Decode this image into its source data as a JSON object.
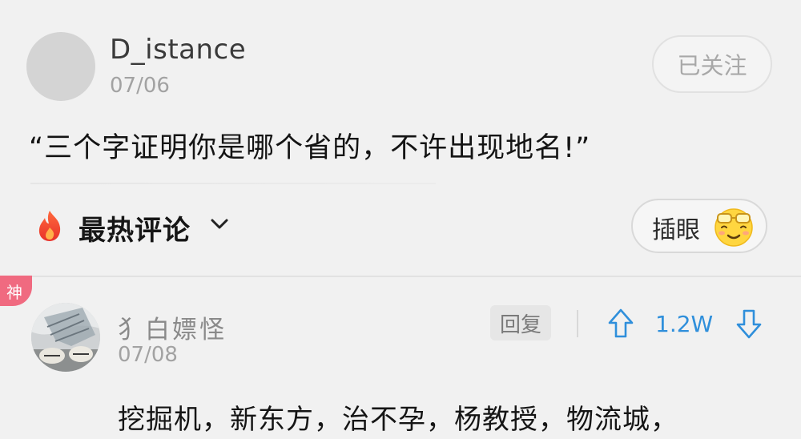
{
  "post": {
    "username": "D_istance",
    "date": "07/06",
    "follow_label": "已关注",
    "title": "“三个字证明你是哪个省的，不许出现地名!”",
    "avatar_icon": "default-avatar"
  },
  "comments_bar": {
    "label": "最热评论",
    "fire_icon": "fire-icon",
    "sort_icon": "chevron-down-icon",
    "insert_label": "插眼",
    "insert_icon": "sunglasses-smile-emoji"
  },
  "comment": {
    "badge": "神",
    "username": "犭白嫖怪",
    "date": "07/08",
    "reply_label": "回复",
    "vote_count": "1.2W",
    "text": "挖掘机，新东方，治不孕，杨教授，物流城，",
    "colors": {
      "badge": "#f06a80",
      "vote": "#2f8fdb"
    }
  }
}
